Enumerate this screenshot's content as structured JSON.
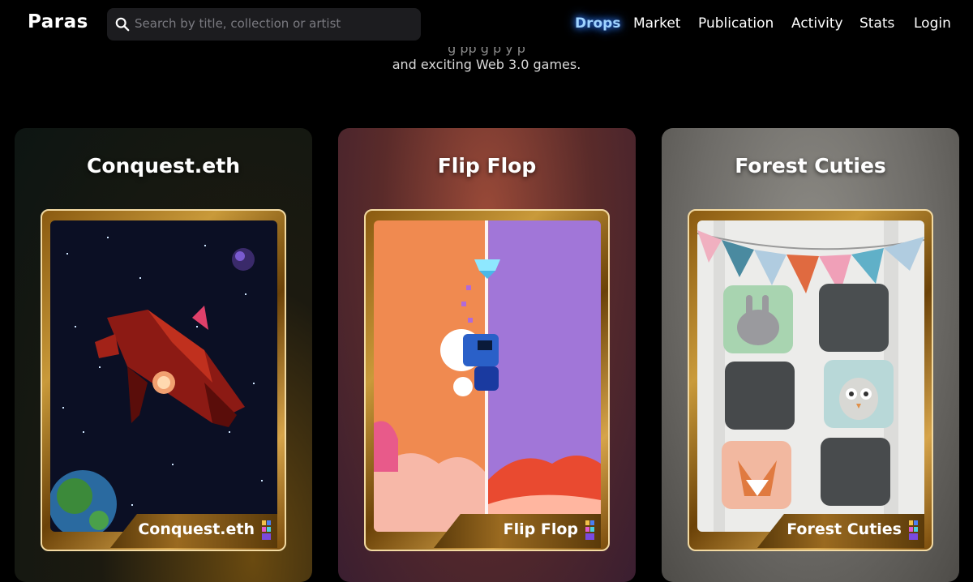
{
  "brand": {
    "logo_text": "Paras"
  },
  "search": {
    "placeholder": "Search by title, collection or artist"
  },
  "nav": {
    "items": [
      {
        "label": "Drops",
        "active": true
      },
      {
        "label": "Market",
        "active": false
      },
      {
        "label": "Publication",
        "active": false
      },
      {
        "label": "Activity",
        "active": false
      },
      {
        "label": "Stats",
        "active": false
      },
      {
        "label": "Login",
        "active": false
      }
    ]
  },
  "intro": {
    "line1": "g          pp    g                                         p          y                    p",
    "line2": "and exciting Web 3.0 games."
  },
  "drops": [
    {
      "title": "Conquest.eth",
      "card_name": "Conquest.eth"
    },
    {
      "title": "Flip Flop",
      "card_name": "Flip Flop"
    },
    {
      "title": "Forest Cuties",
      "card_name": "Forest Cuties"
    }
  ],
  "colors": {
    "nav_active_glow": "#2f7bff",
    "card_gold": "#c99a3a"
  }
}
